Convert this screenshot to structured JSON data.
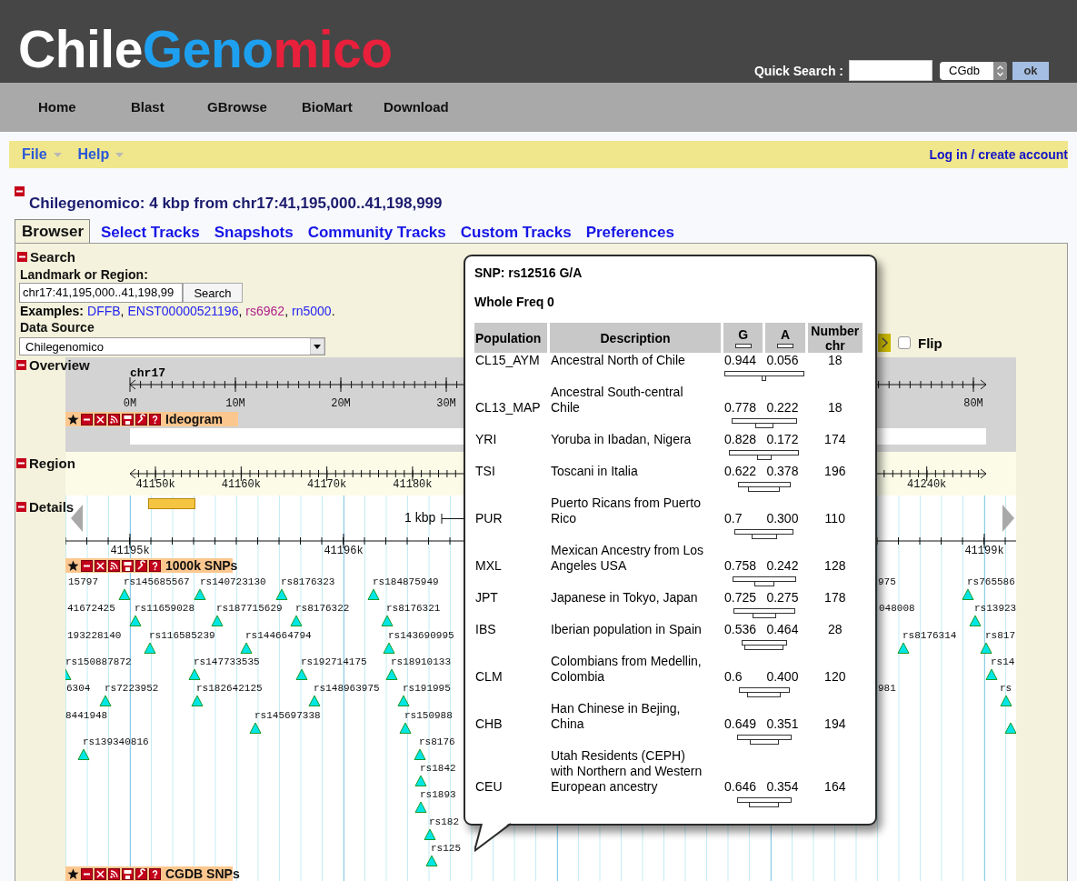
{
  "header": {
    "logo": [
      {
        "text": "Chile",
        "color": "#ffffff"
      },
      {
        "text": "Geno",
        "color": "#1ea0f0"
      },
      {
        "text": "mico",
        "color": "#e8203c"
      }
    ],
    "quick_search": {
      "label": "Quick Search :",
      "select": "CGdb",
      "button": "ok"
    }
  },
  "nav": [
    "Home",
    "Blast",
    "GBrowse",
    "BioMart",
    "Download"
  ],
  "menubar": {
    "menus": [
      "File",
      "Help"
    ],
    "login": "Log in / create account"
  },
  "title": "Chilegenomico: 4 kbp from chr17:41,195,000..41,198,999",
  "tabs": [
    {
      "label": "Browser",
      "selected": true
    },
    {
      "label": "Select Tracks",
      "selected": false
    },
    {
      "label": "Snapshots",
      "selected": false
    },
    {
      "label": "Community Tracks",
      "selected": false
    },
    {
      "label": "Custom Tracks",
      "selected": false
    },
    {
      "label": "Preferences",
      "selected": false
    }
  ],
  "search": {
    "heading": "Search",
    "landmark_label": "Landmark or Region:",
    "landmark_value": "chr17:41,195,000..41,198,99",
    "search_button": "Search",
    "examples_label": "Examples:",
    "examples": [
      {
        "text": "DFFB",
        "color": "#2424f0",
        "after": ","
      },
      {
        "text": "ENST00000521196",
        "color": "#2424f0",
        "after": ","
      },
      {
        "text": "rs6962",
        "color": "#b0208a",
        "after": ","
      },
      {
        "text": "rn5000",
        "color": "#2424f0",
        "after": "."
      }
    ],
    "data_source_label": "Data Source",
    "data_source": "Chilegenomico"
  },
  "flip": {
    "label": "Flip",
    "checked": false
  },
  "overview": {
    "heading": "Overview",
    "chromosome": "chr17",
    "ticks": [
      "0M",
      "10M",
      "20M",
      "30M",
      "80M"
    ],
    "track": "Ideogram"
  },
  "region": {
    "heading": "Region",
    "ticks": [
      "41150k",
      "41160k",
      "41170k",
      "41180k",
      "41240k"
    ]
  },
  "details": {
    "heading": "Details",
    "scale": "1 kbp",
    "ticks": [
      "41195k",
      "41196k",
      "41199k"
    ],
    "tracks": [
      {
        "title": "1000k SNPs",
        "features": [
          "15797",
          "rs145685567",
          "rs140723130",
          "rs8176323",
          "rs184875949",
          "975",
          "rs765586",
          "41672425",
          "rs11659028",
          "rs187715629",
          "rs8176322",
          "rs8176321",
          "048008",
          "rs13923",
          "193228140",
          "rs116585239",
          "rs144664794",
          "rs143690995",
          "rs8176314",
          "rs817",
          "rs150887872",
          "rs147733535",
          "rs192714175",
          "rs18910133",
          "rs14",
          "6304",
          "rs7223952",
          "rs182642125",
          "rs148963975",
          "rs191995",
          "981",
          "rs",
          "8441948",
          "rs145697338",
          "rs150988",
          "rs139340816",
          "rs8176",
          "rs1842",
          "rs1893",
          "rs182",
          "rs125"
        ]
      },
      {
        "title": "CGDB SNPs"
      }
    ]
  },
  "popup": {
    "title": "SNP: rs12516 G/A",
    "whole_freq": "Whole Freq 0",
    "columns": [
      "Population",
      "Description",
      "G",
      "A",
      "Number chr"
    ],
    "rows": [
      {
        "population": "CL15_AYM",
        "description": "Ancestral North of Chile",
        "g": "0.944",
        "a": "0.056",
        "number": "18"
      },
      {
        "population": "CL13_MAP",
        "description": "Ancestral South-central\nChile",
        "g": "0.778",
        "a": "0.222",
        "number": "18"
      },
      {
        "population": "YRI",
        "description": "Yoruba in Ibadan, Nigera",
        "g": "0.828",
        "a": "0.172",
        "number": "174"
      },
      {
        "population": "TSI",
        "description": "Toscani in Italia",
        "g": "0.622",
        "a": "0.378",
        "number": "196"
      },
      {
        "population": "PUR",
        "description": "Puerto Ricans from Puerto\nRico",
        "g": "0.7",
        "a": "0.300",
        "number": "110"
      },
      {
        "population": "MXL",
        "description": "Mexican Ancestry from Los\nAngeles USA",
        "g": "0.758",
        "a": "0.242",
        "number": "128"
      },
      {
        "population": "JPT",
        "description": "Japanese in Tokyo, Japan",
        "g": "0.725",
        "a": "0.275",
        "number": "178"
      },
      {
        "population": "IBS",
        "description": "Iberian population in Spain",
        "g": "0.536",
        "a": "0.464",
        "number": "28"
      },
      {
        "population": "CLM",
        "description": "Colombians from Medellin,\nColombia",
        "g": "0.6",
        "a": "0.400",
        "number": "120"
      },
      {
        "population": "CHB",
        "description": "Han Chinese in Bejing,\nChina",
        "g": "0.649",
        "a": "0.351",
        "number": "194"
      },
      {
        "population": "CEU",
        "description": "Utah Residents (CEPH)\nwith Northern and Western\nEuropean ancestry",
        "g": "0.646",
        "a": "0.354",
        "number": "164"
      }
    ]
  }
}
